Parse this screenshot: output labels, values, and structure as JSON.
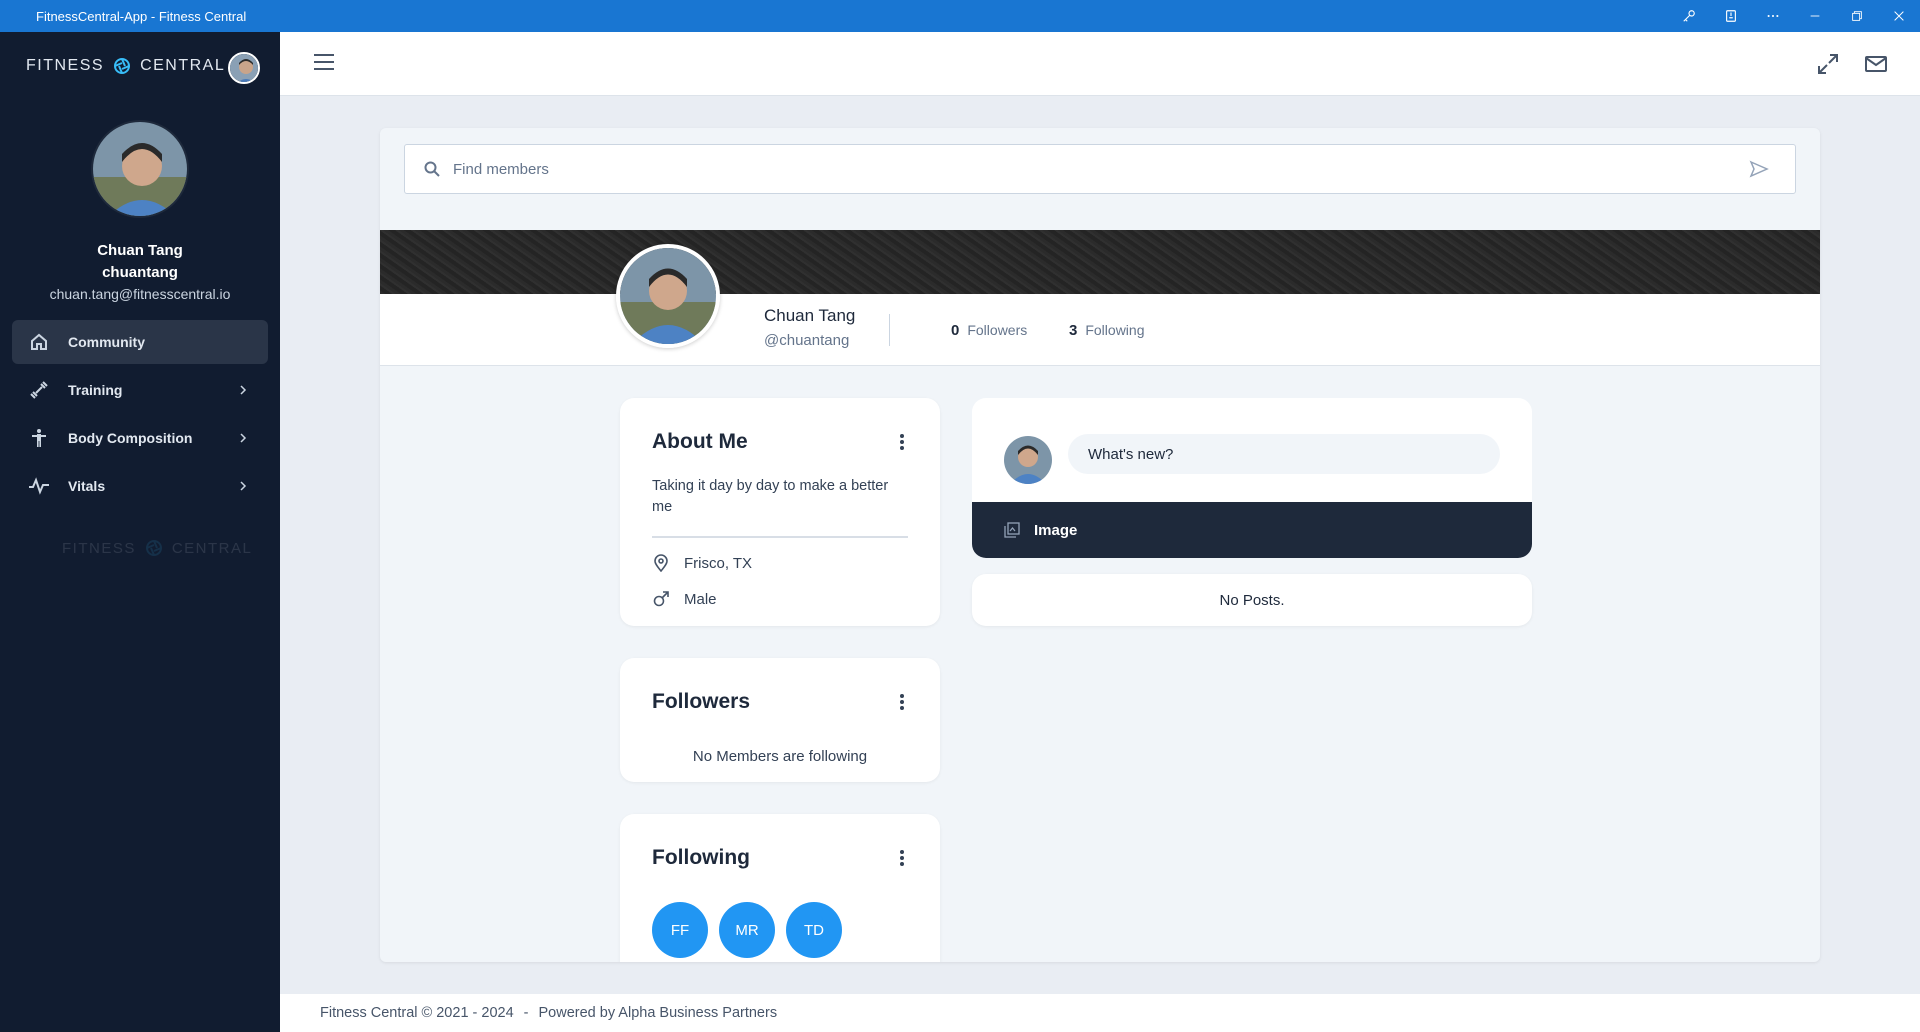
{
  "window": {
    "title": "FitnessCentral-App - Fitness Central",
    "controls": [
      "key-icon",
      "cast-icon",
      "more-icon",
      "minimize-icon",
      "restore-icon",
      "close-icon"
    ]
  },
  "brand": {
    "left": "FITNESS",
    "right": "CENTRAL"
  },
  "user": {
    "full_name": "Chuan Tang",
    "username": "chuantang",
    "email": "chuan.tang@fitnesscentral.io",
    "handle": "@chuantang"
  },
  "nav": {
    "items": [
      {
        "label": "Community",
        "icon": "home-icon",
        "active": true
      },
      {
        "label": "Training",
        "icon": "dumbbell-icon"
      },
      {
        "label": "Body Composition",
        "icon": "body-icon"
      },
      {
        "label": "Vitals",
        "icon": "pulse-icon"
      }
    ]
  },
  "search": {
    "placeholder": "Find members"
  },
  "profile": {
    "followers_count": "0",
    "followers_label": "Followers",
    "following_count": "3",
    "following_label": "Following"
  },
  "about": {
    "title": "About Me",
    "bio": "Taking it day by day to make a better me",
    "location": "Frisco, TX",
    "gender": "Male"
  },
  "followers_panel": {
    "title": "Followers",
    "empty": "No Members are following"
  },
  "following_panel": {
    "title": "Following",
    "members": [
      "FF",
      "MR",
      "TD"
    ]
  },
  "post": {
    "placeholder": "What's new?",
    "image_label": "Image",
    "empty": "No Posts."
  },
  "footer": {
    "copyright": "Fitness Central © 2021 - 2024",
    "separator": "-",
    "powered": "Powered by Alpha Business Partners"
  },
  "colors": {
    "titlebar": "#1976d2",
    "sidebar": "#111c30",
    "accent": "#2196f3",
    "dark_bar": "#1e293b"
  }
}
